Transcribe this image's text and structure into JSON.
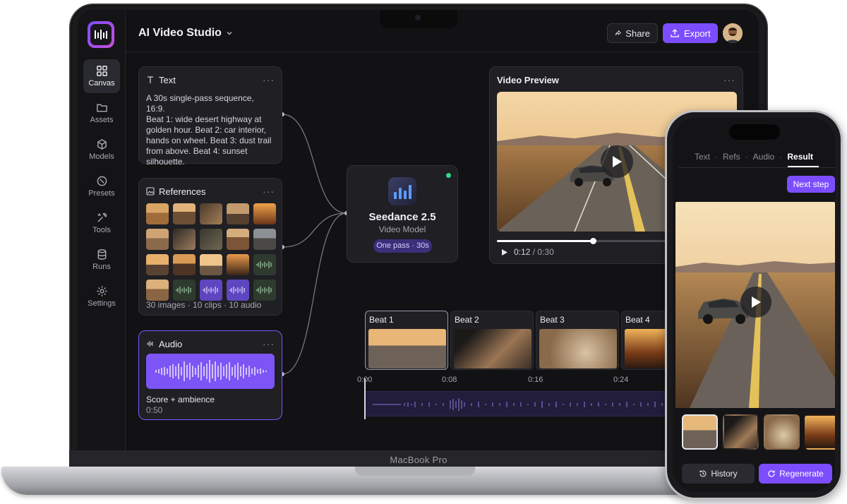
{
  "app": {
    "title": "AI Video Studio",
    "share_label": "Share",
    "export_label": "Export",
    "device_label": "MacBook Pro"
  },
  "sidebar": {
    "items": [
      {
        "label": "Canvas",
        "icon": "grid-icon",
        "active": true
      },
      {
        "label": "Assets",
        "icon": "folder-icon"
      },
      {
        "label": "Models",
        "icon": "cube-icon"
      },
      {
        "label": "Presets",
        "icon": "preset-icon"
      },
      {
        "label": "Tools",
        "icon": "tools-icon"
      },
      {
        "label": "Runs",
        "icon": "database-icon"
      },
      {
        "label": "Settings",
        "icon": "gear-icon"
      }
    ]
  },
  "canvas": {
    "text_node": {
      "title": "Text",
      "body": "A 30s single-pass sequence, 16:9.\nBeat 1: wide desert highway at\ngolden hour. Beat 2: car interior,\nhands on wheel. Beat 3: dust trail\nfrom above. Beat 4: sunset\nsilhouette."
    },
    "references_node": {
      "title": "References",
      "summary": "30 images · 10 clips · 10 audio"
    },
    "audio_node": {
      "title": "Audio",
      "label": "Score + ambience",
      "duration": "0:50"
    },
    "model_node": {
      "name": "Seedance 2.5",
      "subtitle": "Video Model",
      "badge": "One pass · 30s",
      "status_color": "#3cd38a"
    },
    "preview_node": {
      "title": "Video Preview",
      "current_time": "0:12",
      "separator": "/",
      "total_time": "0:30",
      "progress": 0.4
    }
  },
  "timeline": {
    "beats": [
      "Beat 1",
      "Beat 2",
      "Beat 3",
      "Beat 4"
    ],
    "ticks": [
      "0:00",
      "0:08",
      "0:16",
      "0:24"
    ]
  },
  "phone": {
    "tabs": [
      "Text",
      "Refs",
      "Audio",
      "Result"
    ],
    "active_tab": "Result",
    "next_label": "Next step",
    "history_label": "History",
    "regenerate_label": "Regenerate"
  },
  "colors": {
    "accent": "#7c4dff",
    "background": "#121214",
    "card": "#1f1f24"
  }
}
